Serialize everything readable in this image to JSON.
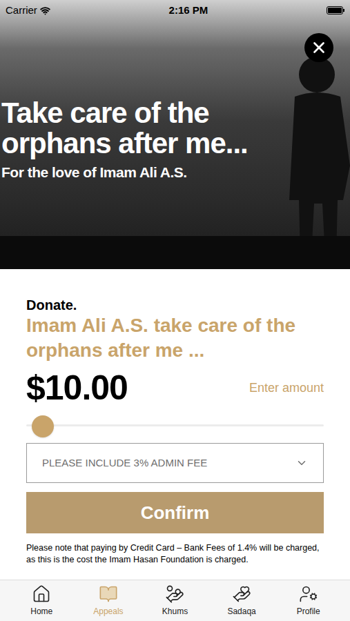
{
  "status_bar": {
    "carrier": "Carrier",
    "time": "2:16 PM"
  },
  "hero": {
    "headline": "Take care of the orphans after me...",
    "subheadline": "For the love of Imam Ali A.S."
  },
  "donate": {
    "label": "Donate.",
    "title": "Imam Ali A.S. take care of the orphans after me ...",
    "amount": "$10.00",
    "enter_amount": "Enter amount",
    "slider": {
      "level": 0
    }
  },
  "fee_select": {
    "value": "PLEASE INCLUDE 3% ADMIN FEE"
  },
  "confirm_button": "Confirm",
  "note": "Please note that paying by Credit Card – Bank Fees of 1.4% will be charged, as this is the cost the Imam Hasan Foundation is charged.",
  "tabs": [
    {
      "label": "Home",
      "selected": false
    },
    {
      "label": "Appeals",
      "selected": true
    },
    {
      "label": "Khums",
      "selected": false
    },
    {
      "label": "Sadaqa",
      "selected": false
    },
    {
      "label": "Profile",
      "selected": false
    }
  ]
}
